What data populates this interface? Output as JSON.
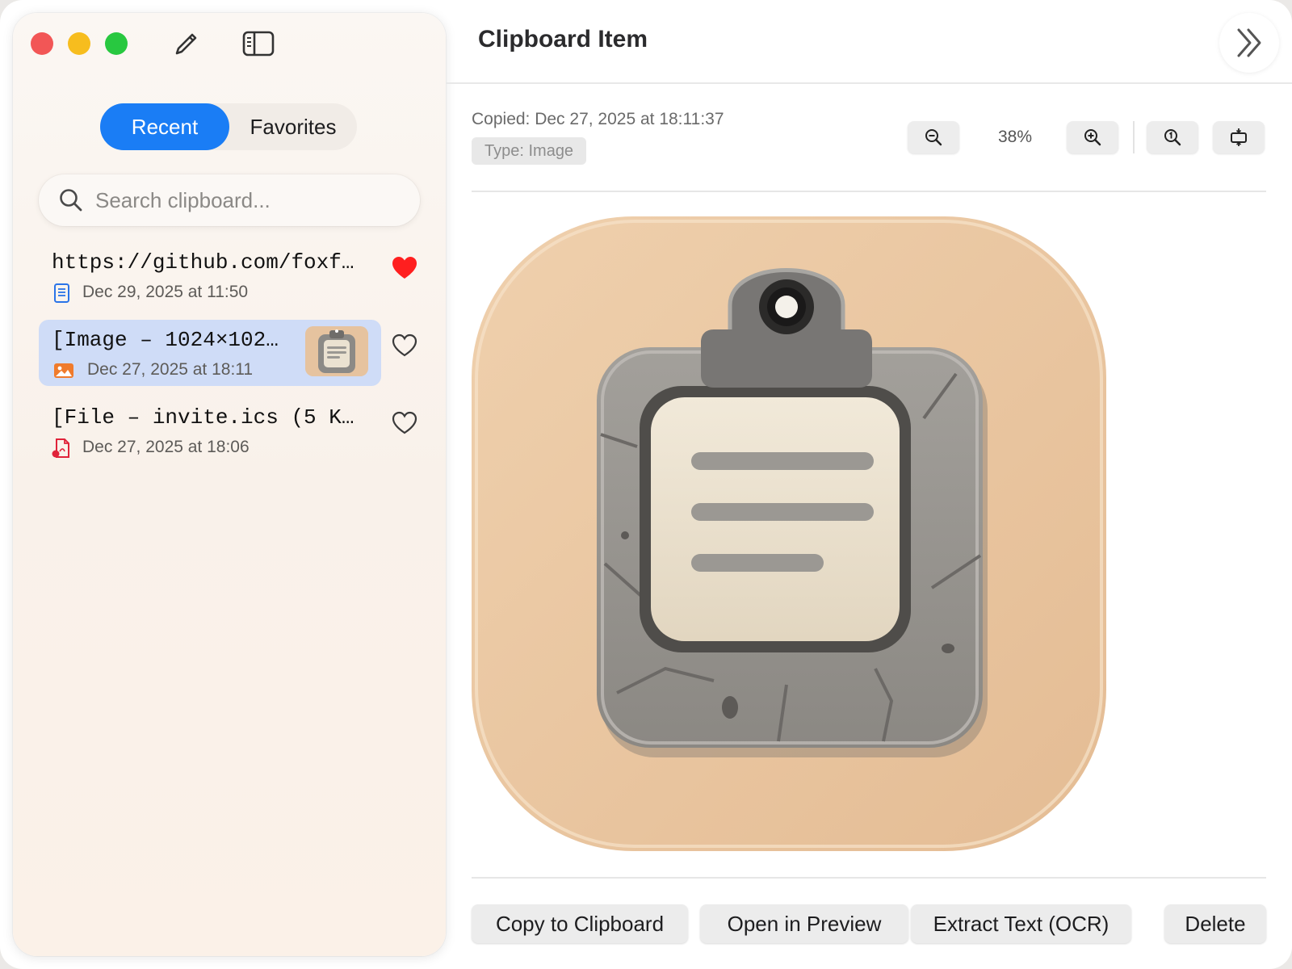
{
  "sidebar": {
    "tabs": [
      {
        "label": "Recent",
        "selected": true
      },
      {
        "label": "Favorites",
        "selected": false
      }
    ],
    "search": {
      "placeholder": "Search clipboard...",
      "value": ""
    },
    "items": [
      {
        "title": "https://github.com/foxf…",
        "date": "Dec 29, 2025 at 11:50",
        "type_icon": "document-icon",
        "favorite": true,
        "selected": false
      },
      {
        "title": "[Image – 1024×102…",
        "date": "Dec 27, 2025 at 18:11",
        "type_icon": "image-icon",
        "favorite": false,
        "selected": true
      },
      {
        "title": "[File – invite.ics (5 K…",
        "date": "Dec 27, 2025 at 18:06",
        "type_icon": "pdf-file-icon",
        "favorite": false,
        "selected": false
      }
    ]
  },
  "main": {
    "title": "Clipboard Item",
    "copied": "Copied: Dec 27, 2025 at 18:11:37",
    "type": "Type: Image",
    "zoom": "38%",
    "actions": {
      "copy": "Copy to Clipboard",
      "preview": "Open in Preview",
      "ocr": "Extract Text (OCR)",
      "delete": "Delete"
    }
  },
  "colors": {
    "accent": "#1a7df5",
    "favorite_heart": "#ff1f1f",
    "selected_row": "#cfdcf7",
    "icon_background": "#e6c39f"
  }
}
